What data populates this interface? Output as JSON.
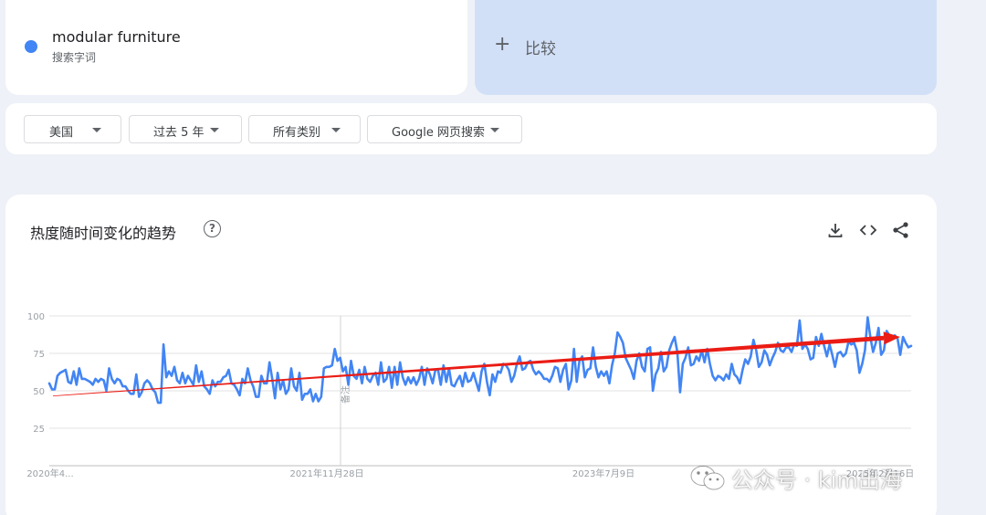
{
  "search_term": {
    "name": "modular furniture",
    "type": "搜索字词",
    "color": "#4285f4"
  },
  "compare": {
    "plus": "+",
    "label": "比较"
  },
  "filters": [
    {
      "label": "美国"
    },
    {
      "label": "过去 5 年"
    },
    {
      "label": "所有类别"
    },
    {
      "label": "Google 网页搜索"
    }
  ],
  "card": {
    "title": "热度随时间变化的趋势",
    "help": "?",
    "icons": [
      "download-icon",
      "embed-code-icon",
      "share-icon"
    ]
  },
  "chart_data": {
    "type": "line",
    "y_ticks": [
      "100",
      "75",
      "50",
      "25"
    ],
    "ylim": [
      0,
      100
    ],
    "x_tick_labels": [
      "2020年4...",
      "2021年11月28日",
      "2023年7月9日",
      "2025年2月16日"
    ],
    "annotation": "备注",
    "grid": true,
    "series": [
      {
        "color": "#4285f4",
        "values": [
          55,
          51,
          51,
          60,
          62,
          63,
          64,
          56,
          55,
          63,
          54,
          65,
          58,
          58,
          57,
          56,
          54,
          58,
          56,
          58,
          57,
          50,
          65,
          58,
          55,
          58,
          57,
          53,
          53,
          50,
          48,
          48,
          61,
          46,
          49,
          55,
          57,
          55,
          51,
          49,
          42,
          42,
          81,
          59,
          63,
          60,
          66,
          57,
          55,
          62,
          55,
          60,
          57,
          54,
          67,
          56,
          63,
          53,
          51,
          48,
          57,
          53,
          56,
          56,
          59,
          60,
          64,
          55,
          54,
          51,
          47,
          58,
          55,
          65,
          57,
          53,
          46,
          46,
          60,
          55,
          55,
          69,
          58,
          45,
          62,
          51,
          57,
          48,
          51,
          65,
          53,
          50,
          62,
          44,
          48,
          48,
          51,
          43,
          48,
          43,
          46,
          65,
          66,
          66,
          67,
          78,
          70,
          72,
          63,
          66,
          54,
          70,
          60,
          58,
          64,
          55,
          66,
          58,
          56,
          60,
          62,
          54,
          69,
          56,
          58,
          66,
          52,
          66,
          54,
          69,
          59,
          54,
          59,
          55,
          59,
          54,
          58,
          66,
          54,
          65,
          61,
          55,
          64,
          64,
          54,
          67,
          56,
          65,
          54,
          53,
          57,
          60,
          53,
          62,
          56,
          57,
          62,
          56,
          50,
          63,
          68,
          56,
          47,
          61,
          56,
          63,
          62,
          68,
          67,
          64,
          56,
          60,
          68,
          73,
          64,
          65,
          69,
          70,
          64,
          61,
          63,
          61,
          58,
          58,
          56,
          60,
          66,
          65,
          56,
          64,
          68,
          51,
          57,
          78,
          56,
          70,
          73,
          59,
          64,
          65,
          79,
          66,
          59,
          63,
          60,
          63,
          55,
          67,
          75,
          89,
          86,
          82,
          72,
          68,
          64,
          58,
          70,
          75,
          66,
          63,
          78,
          79,
          50,
          61,
          65,
          76,
          63,
          66,
          77,
          82,
          86,
          76,
          49,
          68,
          72,
          79,
          67,
          68,
          73,
          70,
          77,
          69,
          78,
          68,
          60,
          57,
          60,
          59,
          57,
          61,
          58,
          68,
          61,
          59,
          55,
          64,
          71,
          68,
          73,
          84,
          77,
          66,
          69,
          77,
          74,
          67,
          72,
          76,
          82,
          77,
          76,
          79,
          79,
          76,
          81,
          80,
          97,
          78,
          81,
          78,
          71,
          72,
          86,
          80,
          88,
          80,
          73,
          81,
          74,
          66,
          75,
          76,
          73,
          75,
          83,
          81,
          82,
          77,
          62,
          68,
          77,
          99,
          86,
          76,
          82,
          92,
          74,
          77,
          90,
          87,
          86,
          87,
          85,
          74,
          86,
          82,
          79,
          80
        ]
      }
    ],
    "trend_arrow": {
      "color": "#ea1c15",
      "from_value": 49,
      "to_value": 86
    }
  },
  "watermark": {
    "text": "公众号 · kim出海"
  }
}
